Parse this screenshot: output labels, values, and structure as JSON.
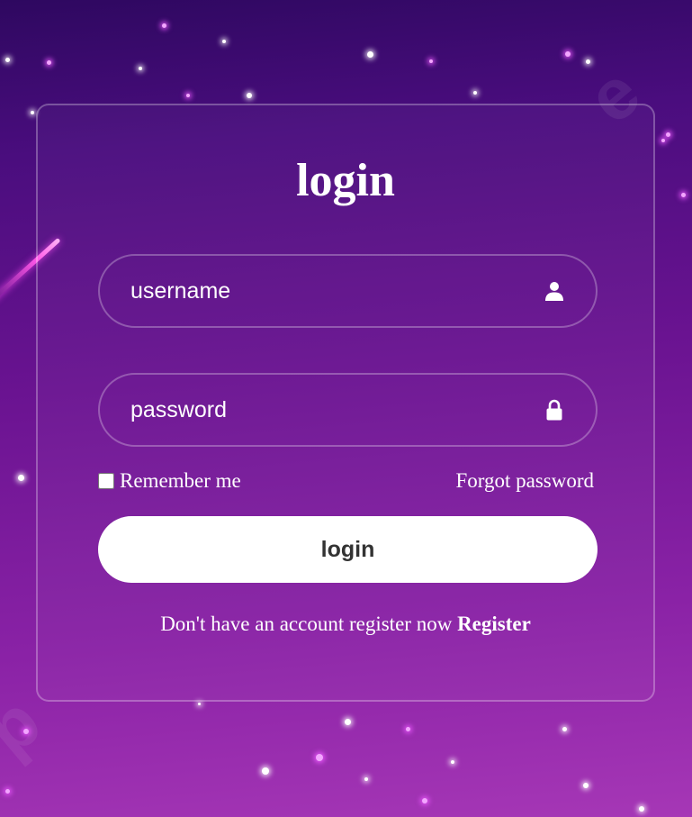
{
  "login_form": {
    "title": "login",
    "username_placeholder": "username",
    "password_placeholder": "password",
    "username_icon": "user-icon",
    "password_icon": "lock-icon",
    "remember_label": "Remember me",
    "remember_checked": false,
    "forgot_label": "Forgot password",
    "submit_label": "login",
    "register_prompt": "Don't have an account register now",
    "register_link": "Register"
  },
  "colors": {
    "background_top": "#2e0860",
    "background_bottom": "#a637b6",
    "button_background": "#ffffff",
    "button_text": "#333333",
    "text": "#ffffff"
  }
}
